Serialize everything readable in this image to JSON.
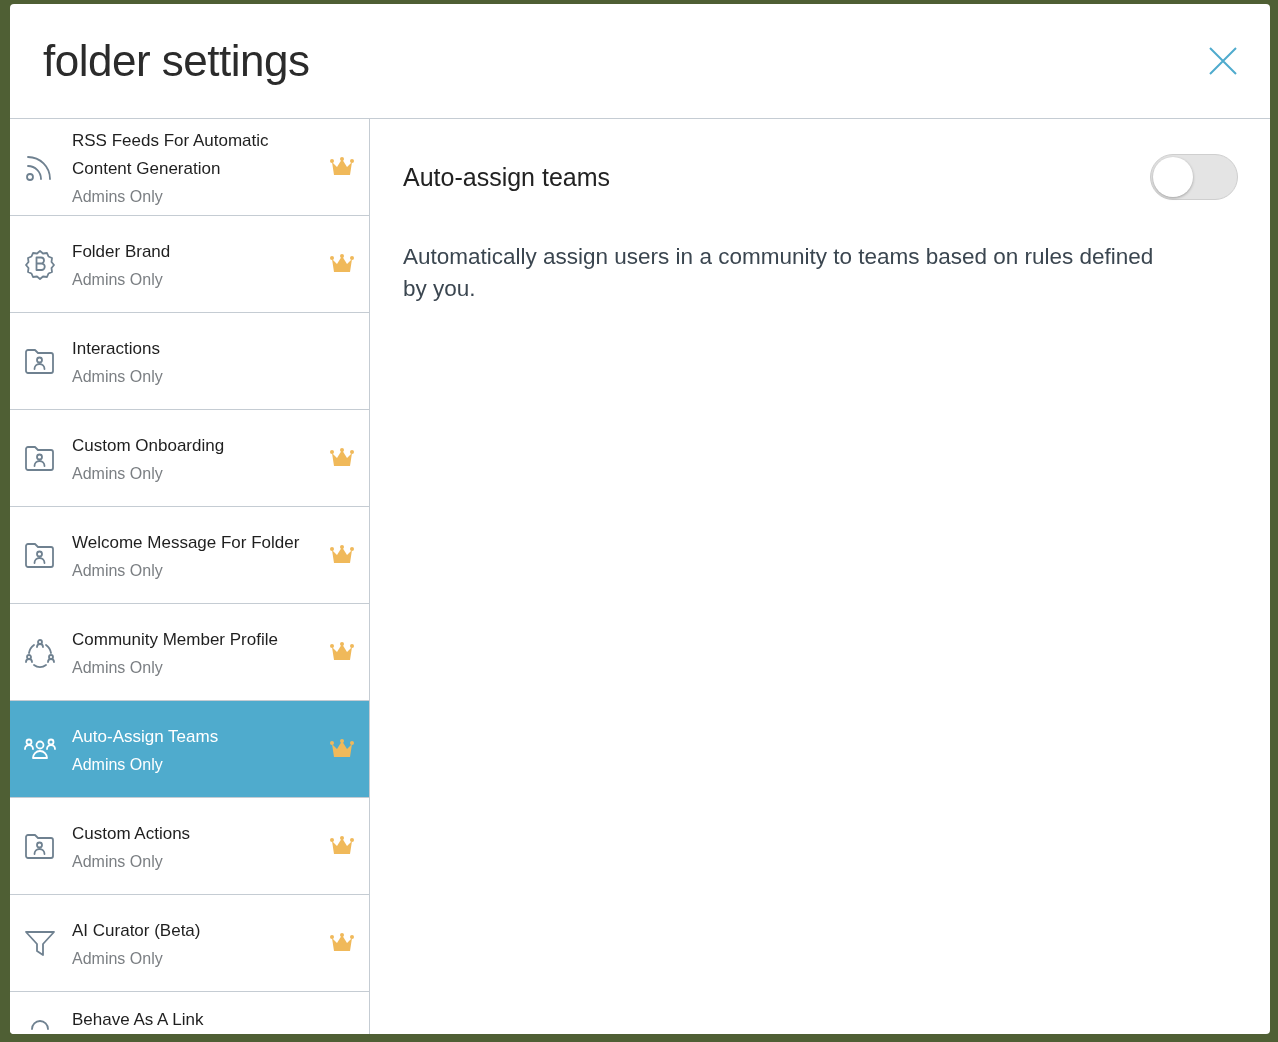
{
  "dialog": {
    "title": "folder settings"
  },
  "sidebar": {
    "items": [
      {
        "kind": "rss",
        "title": "RSS Feeds For Automatic Content Generation",
        "subtitle": "Admins Only",
        "premium": true,
        "selected": false
      },
      {
        "kind": "brand",
        "title": "Folder Brand",
        "subtitle": "Admins Only",
        "premium": true,
        "selected": false
      },
      {
        "kind": "folder-user",
        "title": "Interactions",
        "subtitle": "Admins Only",
        "premium": false,
        "selected": false
      },
      {
        "kind": "folder-user",
        "title": "Custom Onboarding",
        "subtitle": "Admins Only",
        "premium": true,
        "selected": false
      },
      {
        "kind": "folder-user",
        "title": "Welcome Message For Folder",
        "subtitle": "Admins Only",
        "premium": true,
        "selected": false
      },
      {
        "kind": "community",
        "title": "Community Member Profile",
        "subtitle": "Admins Only",
        "premium": true,
        "selected": false
      },
      {
        "kind": "team",
        "title": "Auto-Assign Teams",
        "subtitle": "Admins Only",
        "premium": true,
        "selected": true
      },
      {
        "kind": "folder-user",
        "title": "Custom Actions",
        "subtitle": "Admins Only",
        "premium": true,
        "selected": false
      },
      {
        "kind": "funnel",
        "title": "AI Curator (Beta)",
        "subtitle": "Admins Only",
        "premium": true,
        "selected": false
      },
      {
        "kind": "link",
        "title": "Behave As A Link",
        "premium": false,
        "selected": false
      }
    ]
  },
  "content": {
    "setting": {
      "label": "Auto-assign teams",
      "on": false
    },
    "description": "Automatically assign users in a community to teams based on rules defined by you."
  }
}
